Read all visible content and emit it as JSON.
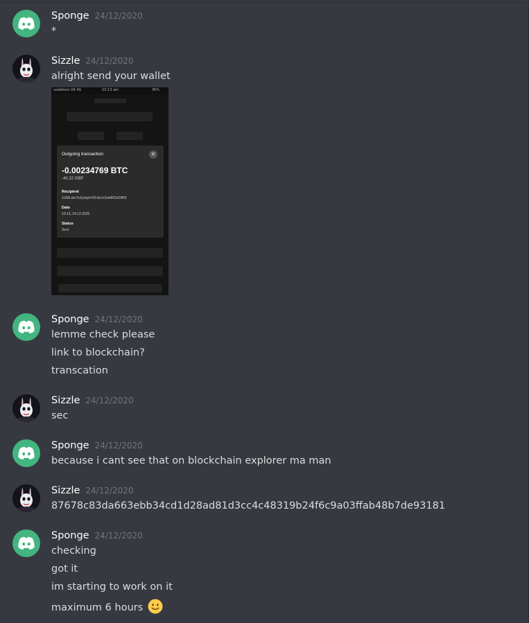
{
  "messages": [
    {
      "user": "Sponge",
      "time": "24/12/2020",
      "lines": [
        "*"
      ]
    },
    {
      "user": "Sizzle",
      "time": "24/12/2020",
      "lines": [
        "alright send your wallet"
      ]
    },
    {
      "user": "Sponge",
      "time": "24/12/2020",
      "lines": [
        "lemme check please",
        "link to blockchain?",
        "transcation"
      ]
    },
    {
      "user": "Sizzle",
      "time": "24/12/2020",
      "lines": [
        "sec"
      ]
    },
    {
      "user": "Sponge",
      "time": "24/12/2020",
      "lines": [
        "because i cant see that on blockchain explorer ma man"
      ]
    },
    {
      "user": "Sizzle",
      "time": "24/12/2020",
      "lines": [
        "87678c83da663ebb34cd1d28ad81d3cc4c48319b24f6c9a03ffab48b7de93181"
      ]
    },
    {
      "user": "Sponge",
      "time": "24/12/2020",
      "lines": [
        "checking",
        "got it",
        "im starting to work on it",
        "maximum 6 hours"
      ]
    }
  ],
  "attachment": {
    "carrier": "vodafone UK  4G",
    "clock": "10:13 am",
    "battery": "36%",
    "title": "Outgoing transaction",
    "amount": "-0.00234769 BTC",
    "fiat": "-40.22 GBP",
    "recipient_label": "Recipient",
    "recipient": "1UMLskcYu2ybqoV42r3eJcGat4RSeDfR9",
    "date_label": "Date",
    "date": "10:13, 24.12.2020",
    "status_label": "Status",
    "status": "Sent"
  },
  "emoji": "slightly-smiling-face",
  "colors": {
    "background": "#36393f",
    "username": "#ffffff",
    "timestamp": "#72767d",
    "text": "#dcddde",
    "discord_avatar": "#43b581"
  }
}
